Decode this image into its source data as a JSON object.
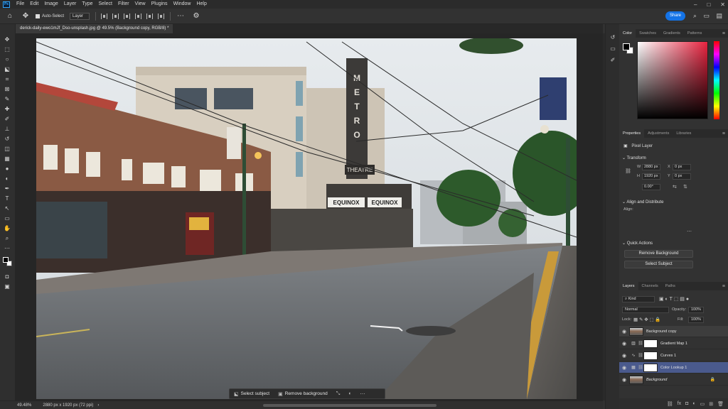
{
  "app": {
    "logo": "Ps",
    "menu": [
      "File",
      "Edit",
      "Image",
      "Layer",
      "Type",
      "Select",
      "Filter",
      "View",
      "Plugins",
      "Window",
      "Help"
    ],
    "window_controls": [
      "–",
      "□",
      "✕"
    ]
  },
  "options_bar": {
    "auto_select_label": "Auto-Select",
    "auto_select_target": "Layer",
    "share_label": "Share"
  },
  "document": {
    "tab_title": "derick-daily-ewo1mJf_Dso-unsplash.jpg @ 49.5% (Background copy, RGB/8) *",
    "zoom": "49.48%",
    "doc_info": "2880 px x 1920 px (72 ppi)"
  },
  "photo_signs": {
    "theatre_vertical": "METRO",
    "theatre_sign": "THEATRE",
    "marquee_left": "EQUINOX",
    "marquee_right": "EQUINOX"
  },
  "contextual_task_bar": {
    "select_subject": "Select subject",
    "remove_background": "Remove background"
  },
  "color_panel": {
    "tabs": [
      "Color",
      "Swatches",
      "Gradients",
      "Patterns"
    ],
    "active_tab": "Color",
    "foreground": "#000000",
    "background": "#ffffff"
  },
  "properties_panel": {
    "tabs": [
      "Properties",
      "Adjustments",
      "Libraries"
    ],
    "layer_type": "Pixel Layer",
    "transform_title": "Transform",
    "width_label": "W",
    "width_value": "2880 px",
    "height_label": "H",
    "height_value": "1920 px",
    "x_label": "X",
    "x_value": "0 px",
    "y_label": "Y",
    "y_value": "0 px",
    "angle_value": "0.00°",
    "align_title": "Align and Distribute",
    "align_label": "Align:",
    "quick_actions_title": "Quick Actions",
    "remove_background_btn": "Remove Background",
    "select_subject_btn": "Select Subject"
  },
  "layers_panel": {
    "tabs": [
      "Layers",
      "Channels",
      "Paths"
    ],
    "filter_kind": "Kind",
    "blend_mode": "Normal",
    "opacity_label": "Opacity:",
    "opacity_value": "100%",
    "lock_label": "Lock:",
    "fill_label": "Fill:",
    "fill_value": "100%",
    "layers": [
      {
        "name": "Background copy",
        "type": "pixel",
        "state": "hover"
      },
      {
        "name": "Gradient Map 1",
        "type": "adjustment",
        "state": "normal"
      },
      {
        "name": "Curves 1",
        "type": "adjustment",
        "state": "normal"
      },
      {
        "name": "Color Lookup 1",
        "type": "adjustment",
        "state": "selected"
      },
      {
        "name": "Background",
        "type": "pixel",
        "state": "locked"
      }
    ]
  },
  "accent_color": "#1473e6",
  "selection_color": "#4a5a8d"
}
